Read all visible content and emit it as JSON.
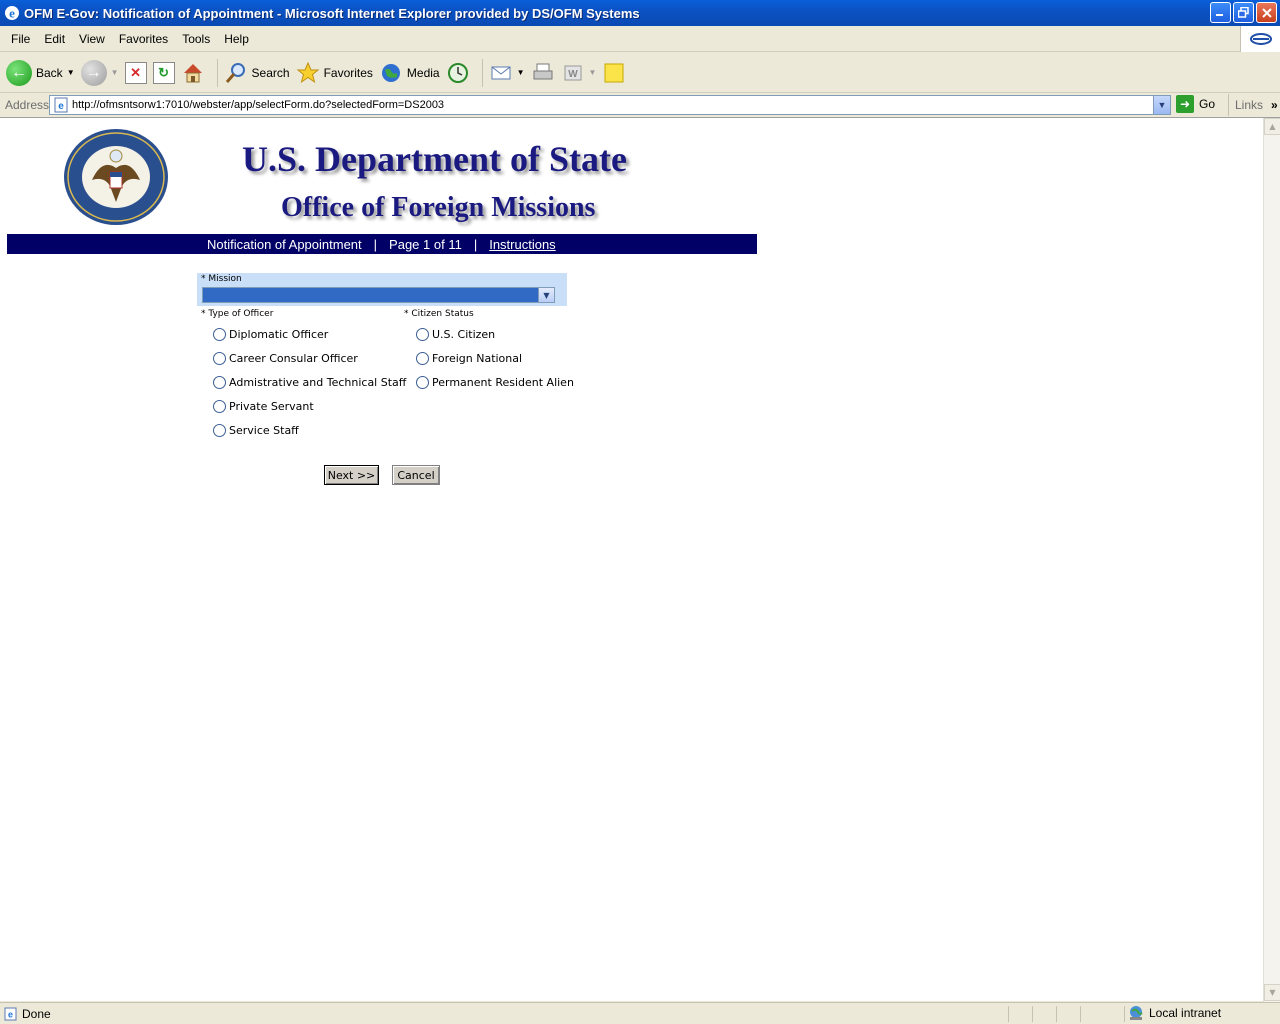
{
  "window": {
    "title": "OFM E-Gov: Notification of Appointment - Microsoft Internet Explorer provided by DS/OFM Systems"
  },
  "menu": [
    "File",
    "Edit",
    "View",
    "Favorites",
    "Tools",
    "Help"
  ],
  "toolbar": {
    "back": "Back",
    "search": "Search",
    "favorites": "Favorites",
    "media": "Media"
  },
  "address": {
    "label": "Address",
    "url": "http://ofmsntsorw1:7010/webster/app/selectForm.do?selectedForm=DS2003",
    "go": "Go",
    "links": "Links"
  },
  "header": {
    "dept": "U.S. Department of State",
    "office": "Office of Foreign Missions"
  },
  "nav": {
    "form_name": "Notification of Appointment",
    "separator": "|",
    "page": "Page 1 of 11",
    "instructions": "Instructions"
  },
  "form": {
    "mission_label": "* Mission",
    "officer_label": "* Type of Officer",
    "citizen_label": "* Citizen Status",
    "officer_types": [
      "Diplomatic Officer",
      "Career Consular Officer",
      "Admistrative and Technical Staff",
      "Private Servant",
      "Service Staff"
    ],
    "citizen_statuses": [
      "U.S. Citizen",
      "Foreign National",
      "Permanent Resident Alien"
    ],
    "next_label": "Next >>",
    "cancel_label": "Cancel"
  },
  "status": {
    "text": "Done",
    "zone": "Local intranet"
  },
  "colors": {
    "nav_band": "#000066",
    "heading": "#1a1a80",
    "mission_bg": "#c9def7",
    "select_fill": "#316ac5"
  }
}
